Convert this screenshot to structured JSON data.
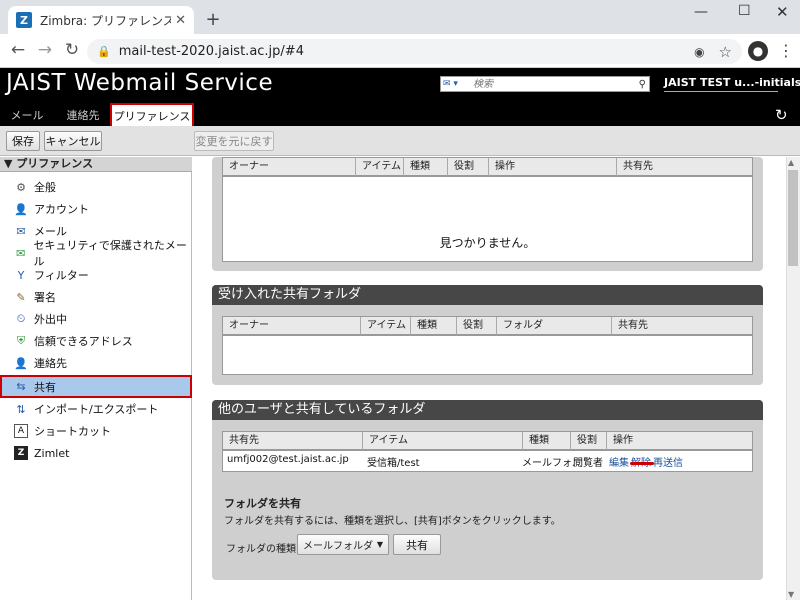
{
  "browser": {
    "tab_title": "Zimbra: プリファレンス: 共有",
    "favicon": "Z",
    "url": "mail-test-2020.jaist.ac.jp/#4"
  },
  "header": {
    "app_title": "JAIST Webmail Service",
    "search_placeholder": "検索",
    "user": "JAIST TEST u...-initials"
  },
  "tabs": {
    "mail": "メール",
    "contacts": "連絡先",
    "prefs": "プリファレンス"
  },
  "actions": {
    "save": "保存",
    "cancel": "キャンセル",
    "revert": "変更を元に戻す"
  },
  "sidebar": {
    "header": "プリファレンス",
    "items": [
      {
        "label": "全般",
        "icon": "gear-icon"
      },
      {
        "label": "アカウント",
        "icon": "account-icon"
      },
      {
        "label": "メール",
        "icon": "mail-icon"
      },
      {
        "label": "セキュリティで保護されたメール",
        "icon": "secure-mail-icon"
      },
      {
        "label": "フィルター",
        "icon": "filter-icon"
      },
      {
        "label": "署名",
        "icon": "signature-icon"
      },
      {
        "label": "外出中",
        "icon": "out-of-office-icon"
      },
      {
        "label": "信頼できるアドレス",
        "icon": "shield-icon"
      },
      {
        "label": "連絡先",
        "icon": "contact-icon"
      },
      {
        "label": "共有",
        "icon": "share-icon"
      },
      {
        "label": "インポート/エクスポート",
        "icon": "import-export-icon"
      },
      {
        "label": "ショートカット",
        "icon": "shortcut-icon"
      },
      {
        "label": "Zimlet",
        "icon": "zimlet-icon"
      }
    ]
  },
  "pending_shares": {
    "columns": [
      "オーナー",
      "アイテム",
      "種類",
      "役割",
      "操作",
      "共有先"
    ],
    "empty_message": "見つかりません。"
  },
  "accepted_shares": {
    "title": "受け入れた共有フォルダ",
    "columns": [
      "オーナー",
      "アイテム",
      "種類",
      "役割",
      "フォルダ",
      "共有先"
    ]
  },
  "shared_by_me": {
    "title": "他のユーザと共有しているフォルダ",
    "columns": [
      "共有先",
      "アイテム",
      "種類",
      "役割",
      "操作"
    ],
    "rows": [
      {
        "shared_with": "umfj002@test.jaist.ac.jp",
        "item": "受信箱/test",
        "type": "メールフォル",
        "role": "閲覧者",
        "actions": [
          "編集",
          "解除",
          "再送信"
        ]
      }
    ]
  },
  "share_folder": {
    "title": "フォルダを共有",
    "description": "フォルダを共有するには、種類を選択し、[共有]ボタンをクリックします。",
    "type_label": "フォルダの種類:",
    "type_value": "メールフォルダ",
    "share_button": "共有"
  }
}
